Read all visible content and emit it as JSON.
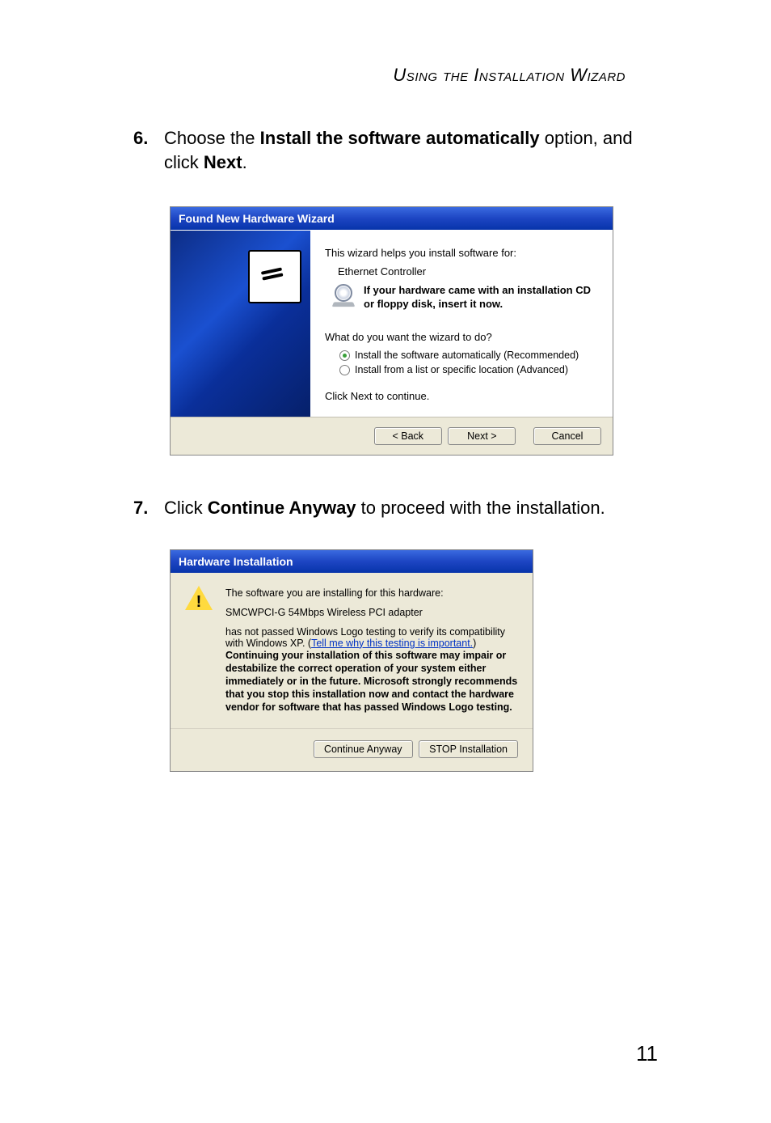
{
  "page_header": "Using the Installation Wizard",
  "steps": {
    "s6": {
      "num": "6.",
      "pre": "Choose the ",
      "b1": "Install the software automatically",
      "mid": " option, and click ",
      "b2": "Next",
      "post": "."
    },
    "s7": {
      "num": "7.",
      "pre": "Click ",
      "b1": "Continue Anyway",
      "post": " to proceed with the installation."
    }
  },
  "wizard": {
    "title": "Found New Hardware Wizard",
    "intro": "This wizard helps you install software for:",
    "device": "Ethernet Controller",
    "cd_hint": "If your hardware came with an installation CD or floppy disk, insert it now.",
    "question": "What do you want the wizard to do?",
    "opt1": "Install the software automatically (Recommended)",
    "opt2": "Install from a list or specific location (Advanced)",
    "click_next": "Click Next to continue.",
    "back": "< Back",
    "next": "Next >",
    "cancel": "Cancel"
  },
  "hwdlg": {
    "title": "Hardware Installation",
    "line1": "The software you are installing for this hardware:",
    "device": "SMCWPCI-G 54Mbps Wireless PCI adapter",
    "not_passed": "has not passed Windows Logo testing to verify its compatibility with Windows XP. (",
    "link": "Tell me why this testing is important.",
    "not_passed_end": ")",
    "warn": "Continuing your installation of this software may impair or destabilize the correct operation of your system either immediately or in the future. Microsoft strongly recommends that you stop this installation now and contact the hardware vendor for software that has passed Windows Logo testing.",
    "cont": "Continue Anyway",
    "stop": "STOP Installation"
  },
  "page_number": "11"
}
